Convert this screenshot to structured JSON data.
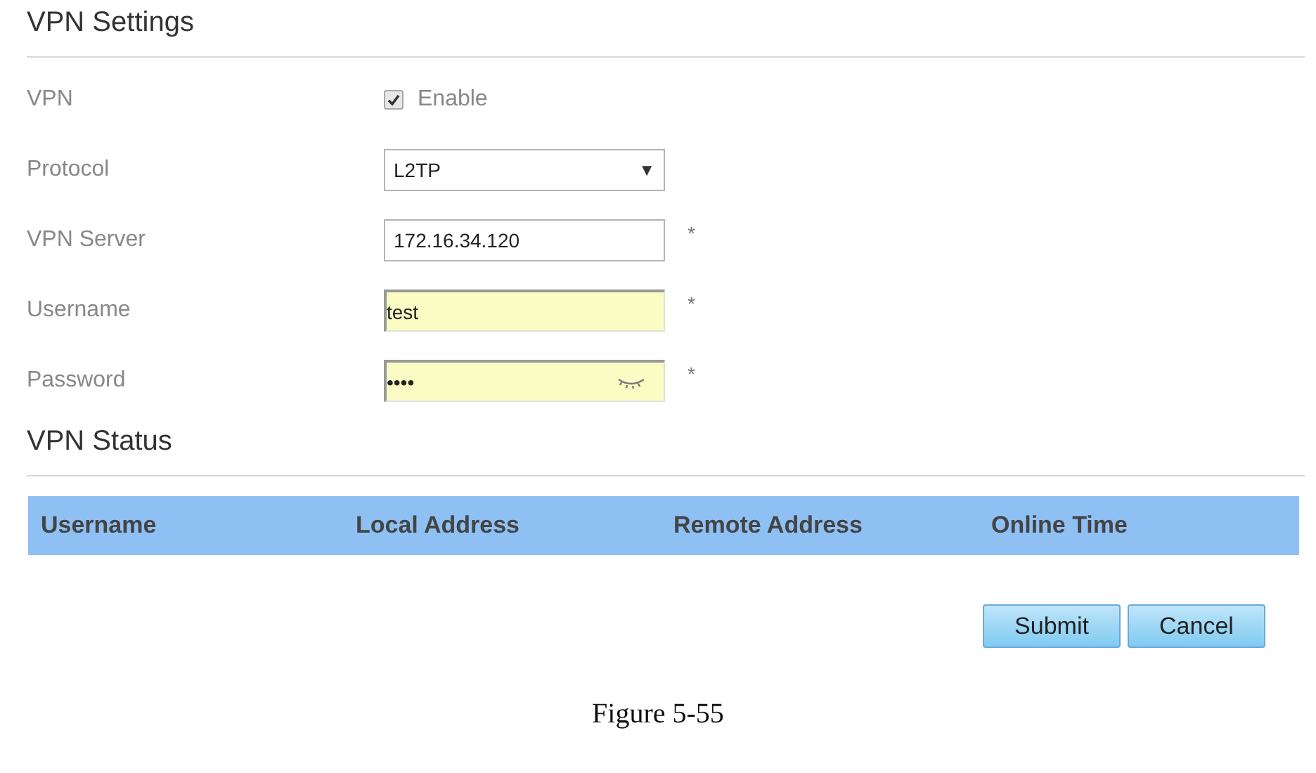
{
  "settings": {
    "title": "VPN Settings",
    "fields": [
      {
        "kind": "checkbox",
        "label": "VPN",
        "option": "Enable",
        "checked": true
      },
      {
        "kind": "select",
        "label": "Protocol",
        "value": "L2TP",
        "arrow": "▼"
      },
      {
        "kind": "text",
        "label": "VPN Server",
        "value": "172.16.34.120",
        "note": "*",
        "autofilled": false
      },
      {
        "kind": "text",
        "label": "Username",
        "value": "test",
        "note": "*",
        "autofilled": true
      },
      {
        "kind": "password",
        "label": "Password",
        "value": "••••",
        "note": "*",
        "autofilled": true
      }
    ]
  },
  "status": {
    "title": "VPN Status",
    "columns": [
      "Username",
      "Local Address",
      "Remote Address",
      "Online Time"
    ]
  },
  "buttons": [
    "Submit",
    "Cancel"
  ],
  "caption": "Figure 5-55"
}
